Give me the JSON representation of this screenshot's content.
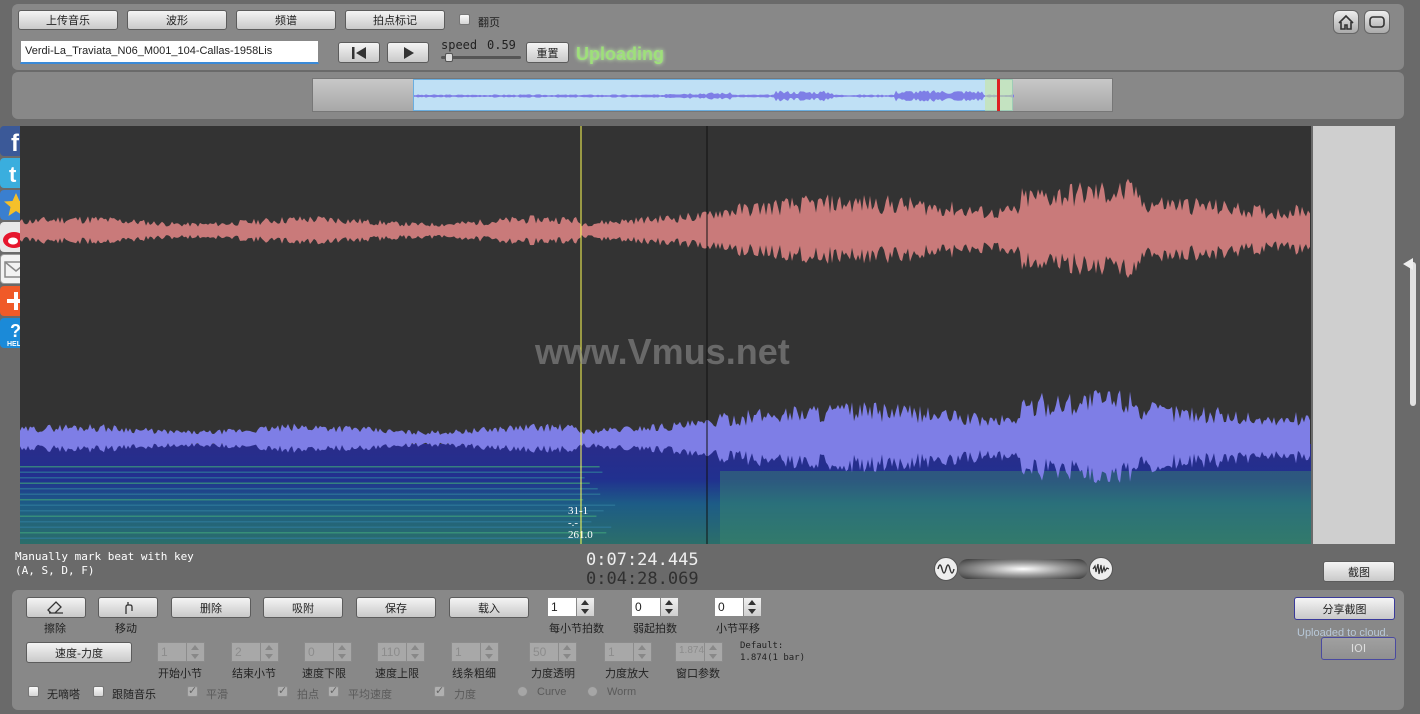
{
  "toolbar": {
    "upload_music": "上传音乐",
    "waveform": "波形",
    "spectrum": "频谱",
    "beat_mark": "拍点标记",
    "page_turn": "翻页"
  },
  "file": {
    "name": "Verdi-La_Traviata_N06_M001_104-Callas-1958Lis"
  },
  "playback": {
    "speed_label": "speed",
    "speed_value": "0.59",
    "speed_fraction": 0.06,
    "reset": "重置",
    "status": "Uploading"
  },
  "canvas": {
    "watermark": "www.Vmus.net",
    "marker_line1": "31-1",
    "marker_line2": "-.-",
    "marker_line3": "261.0"
  },
  "info": {
    "hint_line1": "Manually mark beat with key",
    "hint_line2": "(A, S, D, F)",
    "time_current": "0:07:24.445",
    "time_marker": "0:04:28.069",
    "screenshot": "截图"
  },
  "tools": {
    "erase": "擦除",
    "move": "移动",
    "delete": "删除",
    "snap": "吸附",
    "save": "保存",
    "load": "载入",
    "beats_per_bar_value": "1",
    "beats_per_bar": "每小节拍数",
    "pickup_value": "0",
    "pickup": "弱起拍数",
    "bar_shift_value": "0",
    "bar_shift": "小节平移",
    "share_screenshot": "分享截图",
    "uploaded": "Uploaded to cloud.",
    "ioi": "IOI",
    "speed_dynamics": "速度-力度",
    "start_bar_value": "1",
    "start_bar": "开始小节",
    "end_bar_value": "2",
    "end_bar": "结束小节",
    "speed_low_value": "0",
    "speed_low": "速度下限",
    "speed_high_value": "110",
    "speed_high": "速度上限",
    "line_width_value": "1",
    "line_width": "线条粗细",
    "opacity_value": "50",
    "opacity": "力度透明",
    "dyn_zoom_value": "1",
    "dyn_zoom": "力度放大",
    "window_value": "1.874",
    "window_param": "窗口参数",
    "default_line1": "Default:",
    "default_line2": "1.874(1 bar)",
    "no_tick": "无嘀嗒",
    "follow_music": "跟随音乐",
    "smooth": "平滑",
    "beat_points": "拍点",
    "avg_speed": "平均速度",
    "dynamics": "力度",
    "curve": "Curve",
    "worm": "Worm"
  },
  "icons": [
    "home-icon",
    "window-icon",
    "facebook-icon",
    "twitter-icon",
    "favorite-icon",
    "weibo-icon",
    "mail-icon",
    "add-icon",
    "help-icon",
    "eraser-icon",
    "move-icon",
    "prev-icon",
    "play-icon"
  ],
  "colors": {
    "status_green": "#9ee07a",
    "waveform_top": "#c97a7a",
    "waveform_bottom": "#7e7ee6",
    "canvas_bg": "#333333"
  }
}
